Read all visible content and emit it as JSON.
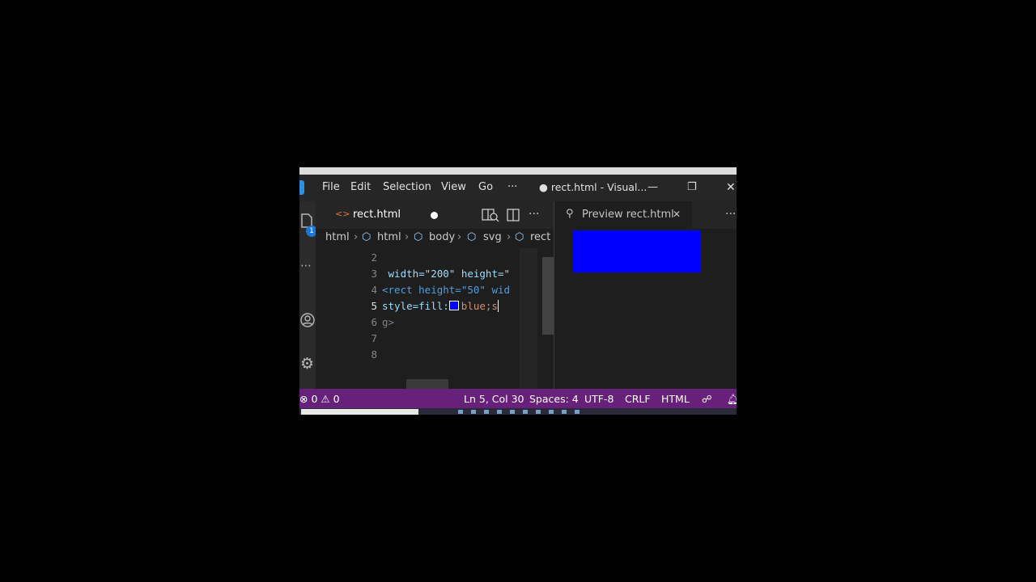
{
  "menu": {
    "items": [
      "File",
      "Edit",
      "Selection",
      "View",
      "Go"
    ],
    "more": "···"
  },
  "window": {
    "title": "● rect.html - Visual...",
    "minimize": "—",
    "restore": "❐",
    "close": "✕"
  },
  "activity": {
    "explorer_badge": "1",
    "icons": [
      "files-icon",
      "ellipsis-icon",
      "account-icon",
      "gear-icon"
    ]
  },
  "editor_tab": {
    "icon": "<>",
    "label": "rect.html"
  },
  "breadcrumbs": [
    "html",
    "html",
    "body",
    "svg",
    "rect"
  ],
  "code_lines": [
    {
      "num": "2",
      "text": ""
    },
    {
      "num": "3",
      "text": " width=\"200\" height=\""
    },
    {
      "num": "4",
      "text": "<rect height=\"50\" wid"
    },
    {
      "num": "5",
      "text": "style=fill:"
    },
    {
      "num": "6",
      "text": "g>"
    },
    {
      "num": "7",
      "text": ""
    },
    {
      "num": "8",
      "text": ""
    }
  ],
  "line5_value": "blue;s",
  "swatch_color": "#0000ff",
  "preview": {
    "tab_label": "Preview rect.html",
    "close": "✕",
    "more": "···",
    "rect_color": "#0000ff"
  },
  "status": {
    "errors": "0",
    "warnings": "0",
    "position": "Ln 5, Col 30",
    "spaces": "Spaces: 4",
    "encoding": "UTF-8",
    "eol": "CRLF",
    "language": "HTML"
  }
}
